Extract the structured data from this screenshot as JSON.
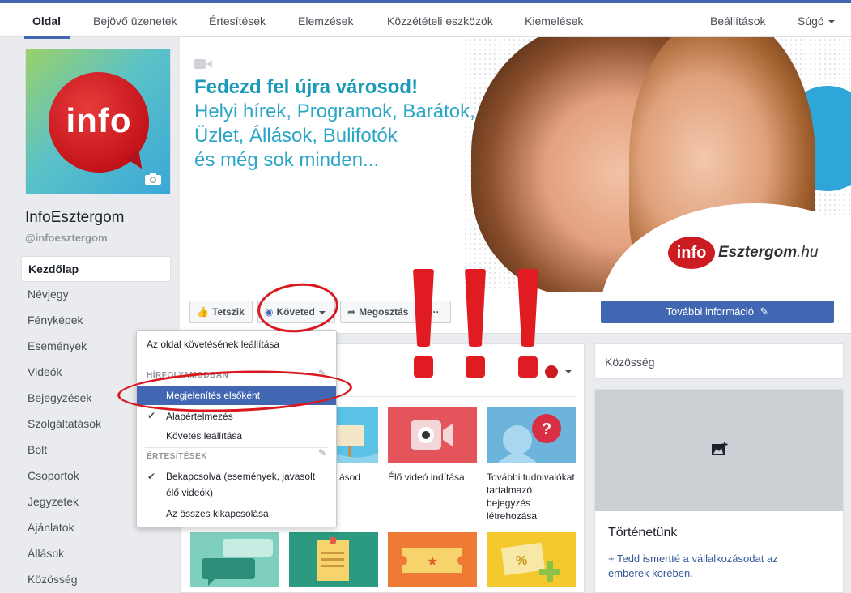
{
  "topnav": {
    "items": [
      "Oldal",
      "Bejövő üzenetek",
      "Értesítések",
      "Elemzések",
      "Közzétételi eszközök",
      "Kiemelések"
    ],
    "settings": "Beállítások",
    "help": "Súgó"
  },
  "profile": {
    "logo_text": "info",
    "name": "InfoEsztergom",
    "handle": "@infoesztergom"
  },
  "leftnav": [
    "Kezdőlap",
    "Névjegy",
    "Fényképek",
    "Események",
    "Videók",
    "Bejegyzések",
    "Szolgáltatások",
    "Bolt",
    "Csoportok",
    "Jegyzetek",
    "Ajánlatok",
    "Állások",
    "Közösség"
  ],
  "cover": {
    "headline": "Fedezd fel újra városod!",
    "lines": [
      "Helyi hírek, Programok, Barátok,",
      "Üzlet, Állások, Bulifotók",
      "és még sok minden..."
    ],
    "brand_pill": "info",
    "brand_name": "Esztergom",
    "brand_tld": ".hu"
  },
  "actions": {
    "like": "Tetszik",
    "following": "Követed",
    "share": "Megosztás",
    "more": "···",
    "more_info": "További információ"
  },
  "dropdown": {
    "stop_following": "Az oldal követésének leállítása",
    "newsfeed_header": "HÍRFOLYAMODBAN",
    "see_first": "Megjelenítés elsőként",
    "default": "Alapértelmezés",
    "unfollow": "Követés leállítása",
    "notifications_header": "ÉRTESÍTÉSEK",
    "on_line1": "Bekapcsolva (események, javasolt",
    "on_line2": "élő videók)",
    "all_off": "Az összes kikapcsolása"
  },
  "create": {
    "tile2_label": "ásod",
    "tile3_label": "Élő videó indítása",
    "tile4_label_lines": [
      "További tudnivalókat",
      "tartalmazó",
      "bejegyzés",
      "létrehozása"
    ]
  },
  "right": {
    "community_title": "Közösség",
    "story_title": "Történetünk",
    "story_link_line1": "+ Tedd ismertté a vállalkozásodat az",
    "story_link_line2": "emberek körében."
  },
  "colors": {
    "brand_blue": "#4267b2",
    "annotation_red": "#e01b22",
    "logo_red": "#cc1b21"
  }
}
